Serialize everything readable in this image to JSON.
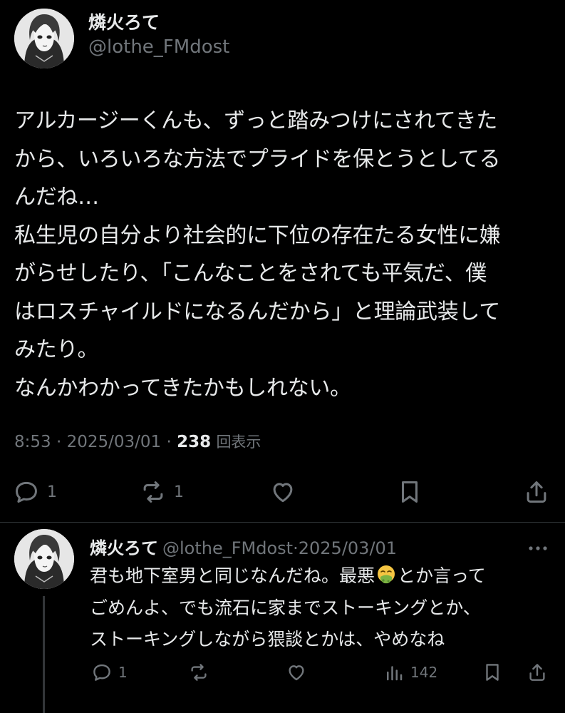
{
  "main_post": {
    "author_name": "燐火ろて",
    "handle": "@lothe_FMdost",
    "text_lines": [
      "アルカージーくんも、ずっと踏みつけにされてきた",
      "から、いろいろな方法でプライドを保とうとしてる",
      "んだね…",
      "私生児の自分より社会的に下位の存在たる女性に嫌",
      "がらせしたり、「こんなことをされても平気だ、僕",
      "はロスチャイルドになるんだから」と理論武装して",
      "みたり。",
      "なんかわかってきたかもしれない。"
    ],
    "time": "8:53",
    "date": "2025/03/01",
    "separator": " · ",
    "views_count": "238",
    "views_label": "回表示",
    "reply_count": "1",
    "repost_count": "1"
  },
  "reply_post": {
    "author_name": "燐火ろて",
    "handle": "@lothe_FMdost",
    "date_separator": "·",
    "date": "2025/03/01",
    "line1_before_emoji": "君も地下室男と同じなんだね。最悪",
    "emoji": "nauseated-face-icon",
    "line1_after_emoji": "とか言って",
    "line2": "ごめんよ、でも流石に家までストーキングとか、",
    "line3": "ストーキングしながら猥談とかは、やめなね",
    "reply_count": "1",
    "views_count": "142"
  },
  "colors": {
    "background": "#000000",
    "text_primary": "#e7e9ea",
    "text_secondary": "#71767b",
    "divider": "#2f3336",
    "emoji_green": "#7cb342"
  }
}
